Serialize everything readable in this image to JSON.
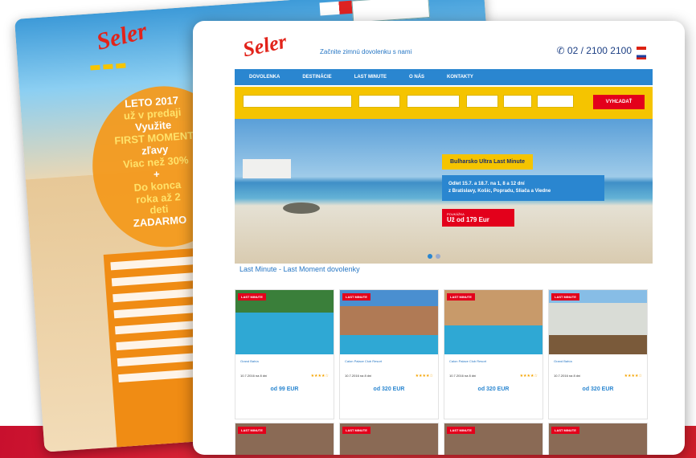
{
  "back_site": {
    "logo": "Seler",
    "promo": [
      "LETO 2017",
      "už v predaji",
      "Využite",
      "FIRST MOMENT",
      "zľavy",
      "Viac než 30%",
      "+",
      "Do konca",
      "roka až 2",
      "deti",
      "ZADARMO"
    ]
  },
  "front_site": {
    "logo": "Seler",
    "slogan": "Začnite zimnú dovolenku s nami",
    "phone": "02 / 2100 2100",
    "nav": [
      "DOVOLENKA",
      "DESTINÁCIE",
      "LAST MINUTE",
      "O NÁS",
      "KONTAKTY"
    ],
    "search_button": "VYHĽADAŤ",
    "hero": {
      "title": "Bulharsko Ultra Last Minute",
      "line1": "Odlet 15.7. a 18.7. na 1, 8 a 12 dní",
      "line2": "z Bratislavy, Košíc, Popradu, Sliača a Viedne",
      "label": "POUKÁŽKA",
      "price": "Už od 179 Eur"
    },
    "section_title": "Last Minute - Last Moment dovolenky",
    "cards": [
      {
        "tag": "LAST MINUTE",
        "name": "Grand Bahía",
        "date": "10.7.2016 na 8 dní",
        "price": "od 99 EUR",
        "img_color": "#2fa8d4"
      },
      {
        "tag": "LAST MINUTE",
        "name": "Calon Palace Club Resort",
        "date": "10.7.2016 na 8 dní",
        "price": "od 320 EUR",
        "img_color": "#b07a55"
      },
      {
        "tag": "LAST MINUTE",
        "name": "Calon Palace Club Resort",
        "date": "10.7.2016 na 8 dní",
        "price": "od 320 EUR",
        "img_color": "#c89a6a"
      },
      {
        "tag": "LAST MINUTE",
        "name": "Grand Bahía",
        "date": "10.7.2016 na 8 dní",
        "price": "od 320 EUR",
        "img_color": "#d9dcd6"
      }
    ],
    "row2_tags": [
      "LAST MINUTE",
      "LAST MINUTE",
      "LAST MINUTE",
      "LAST MINUTE"
    ]
  }
}
